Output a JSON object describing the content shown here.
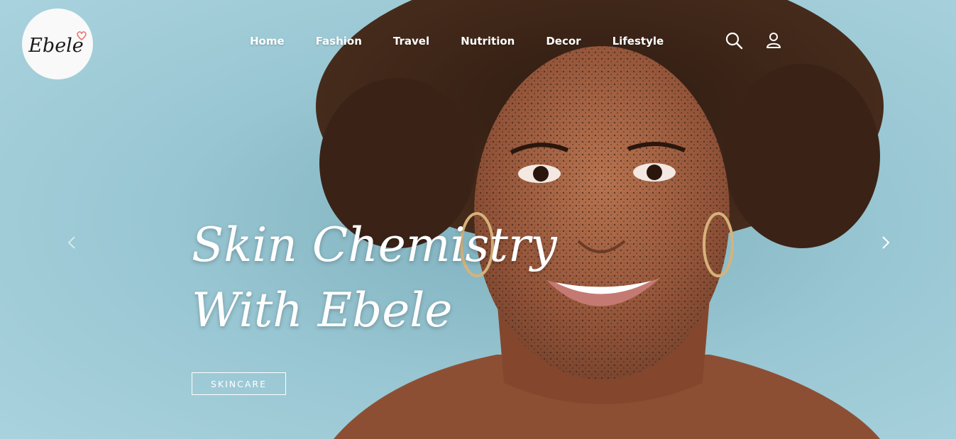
{
  "brand": {
    "name": "Ebele",
    "heart_color": "#e9716d"
  },
  "nav": {
    "items": [
      {
        "label": "Home"
      },
      {
        "label": "Fashion"
      },
      {
        "label": "Travel"
      },
      {
        "label": "Nutrition"
      },
      {
        "label": "Decor"
      },
      {
        "label": "Lifestyle"
      }
    ]
  },
  "header_icons": {
    "search": "search-icon",
    "account": "user-icon"
  },
  "slider": {
    "prev_icon": "chevron-left-icon",
    "next_icon": "chevron-right-icon",
    "headline_line1": "Skin Chemistry",
    "headline_line2": "With Ebele",
    "category_label": "SKINCARE"
  },
  "colors": {
    "background": "#9fcbd6",
    "text": "#ffffff",
    "logo_bg": "#f9f9f9"
  }
}
